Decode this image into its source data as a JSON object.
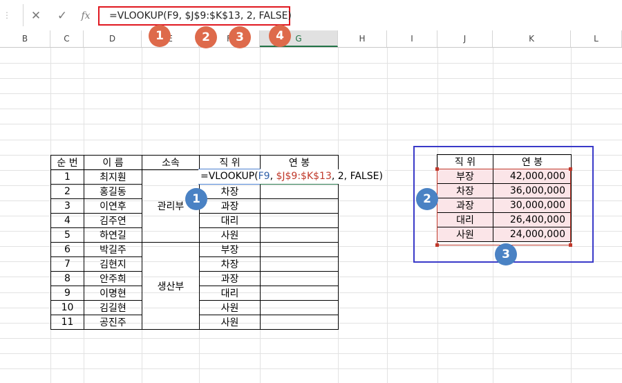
{
  "formula_bar": {
    "cancel_icon": "✕",
    "enter_icon": "✓",
    "fx_label": "fx",
    "formula": "=VLOOKUP(F9, $J$9:$K$13, 2, FALSE)"
  },
  "columns": [
    "B",
    "C",
    "D",
    "E",
    "F",
    "G",
    "H",
    "I",
    "J",
    "K",
    "L"
  ],
  "main_table": {
    "headers": [
      "순 번",
      "이 름",
      "소속",
      "직 위",
      "연 봉"
    ],
    "departments": [
      "관리부",
      "생산부"
    ],
    "rows": [
      {
        "no": "1",
        "name": "최지훤",
        "position": ""
      },
      {
        "no": "2",
        "name": "홍길동",
        "position": "차장"
      },
      {
        "no": "3",
        "name": "이연후",
        "position": "과장"
      },
      {
        "no": "4",
        "name": "김주연",
        "position": "대리"
      },
      {
        "no": "5",
        "name": "하연길",
        "position": "사원"
      },
      {
        "no": "6",
        "name": "박길주",
        "position": "부장"
      },
      {
        "no": "7",
        "name": "김현지",
        "position": "차장"
      },
      {
        "no": "8",
        "name": "안주희",
        "position": "과장"
      },
      {
        "no": "9",
        "name": "이명현",
        "position": "대리"
      },
      {
        "no": "10",
        "name": "김길현",
        "position": "사원"
      },
      {
        "no": "11",
        "name": "공진주",
        "position": "사원"
      }
    ]
  },
  "cell_edit": {
    "prefix": "=VLOOKUP(",
    "ref1": "F9",
    "sep1": ", ",
    "ref2": "$J$9:$K$13",
    "suffix": ", 2, FALSE)"
  },
  "lookup_table": {
    "headers": [
      "직 위",
      "연 봉"
    ],
    "rows": [
      {
        "position": "부장",
        "salary": "42,000,000"
      },
      {
        "position": "차장",
        "salary": "36,000,000"
      },
      {
        "position": "과장",
        "salary": "30,000,000"
      },
      {
        "position": "대리",
        "salary": "26,400,000"
      },
      {
        "position": "사원",
        "salary": "24,000,000"
      }
    ]
  },
  "badges": {
    "top": [
      "1",
      "2",
      "3",
      "4"
    ],
    "cell": "1",
    "lookup_left": "2",
    "lookup_bottom": "3"
  },
  "colors": {
    "badge_orange": "#de6a4b",
    "badge_blue": "#4a82c4",
    "highlight_red": "#e0171f",
    "box_blue": "#3939c8"
  }
}
